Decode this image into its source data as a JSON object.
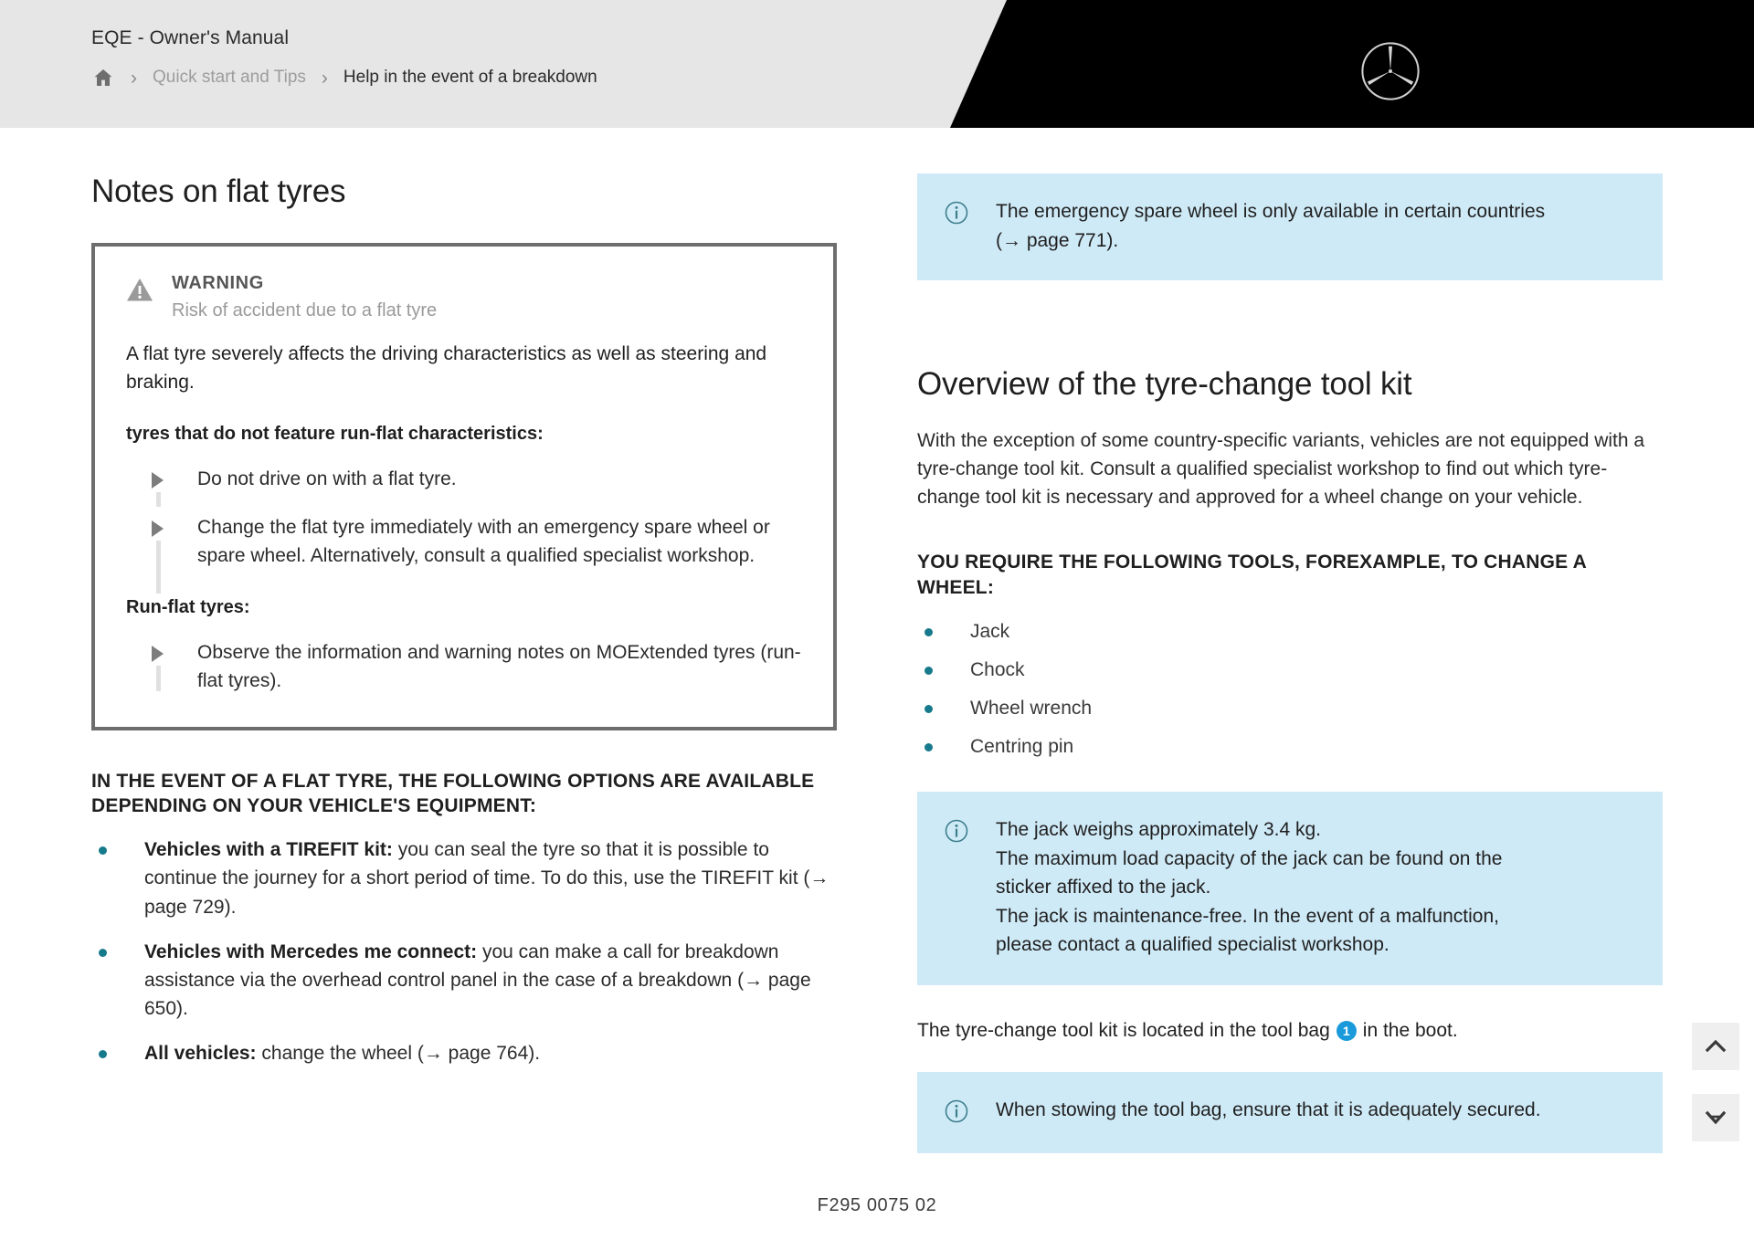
{
  "header": {
    "manual_title": "EQE - Owner's Manual",
    "breadcrumb": {
      "home_icon": "home-icon",
      "separator": "›",
      "parent": "Quick start and Tips",
      "current": "Help in the event of a breakdown"
    },
    "brand_logo": "mercedes-benz-star-icon",
    "colors": {
      "header_bg": "#e6e6e6",
      "banner_black": "#000000"
    }
  },
  "left_column": {
    "section_title": "Notes on flat tyres",
    "warning_box": {
      "icon": "warning-triangle-icon",
      "label": "WARNING",
      "subtitle": "Risk of accident due to a flat tyre",
      "body": "A flat tyre severely affects the driving characteristics as well as steering and braking.",
      "groups": [
        {
          "heading": "tyres that do not feature run-flat characteristics:",
          "items": [
            "Do not drive on with a flat tyre.",
            "Change the flat tyre immediately with an emergency spare wheel or spare wheel. Alternatively, consult a qualified specialist workshop."
          ]
        },
        {
          "heading": "Run-flat tyres:",
          "items": [
            "Observe the information and warning notes on MOExtended tyres (run-flat tyres)."
          ]
        }
      ]
    },
    "options_heading": "IN THE EVENT OF A FLAT TYRE, THE FOLLOWING OPTIONS ARE AVAILABLE DEPENDING ON YOUR VEHICLE'S EQUIPMENT:",
    "options": [
      {
        "bold": "Vehicles with a TIREFIT kit:",
        "rest": " you can seal the tyre so that it is possible to continue the journey for a short period of time. To do this, use the TIREFIT kit (→ page 729)."
      },
      {
        "bold": "Vehicles with Mercedes me connect:",
        "rest": " you can make a call for breakdown assistance via the overhead control panel in the case of a breakdown (→ page 650)."
      },
      {
        "bold": "All vehicles:",
        "rest": " change the wheel (→ page 764)."
      }
    ]
  },
  "right_column": {
    "info_box_top": {
      "icon": "info-circle-icon",
      "lines": [
        "The emergency spare wheel is only available in certain countries",
        "(→ page 771)."
      ]
    },
    "section_title": "Overview of the tyre-change tool kit",
    "paragraph": "With the exception of some country-specific variants, vehicles are not equipped with a tyre-change tool kit. Consult a qualified specialist workshop to find out which tyre-change tool kit is necessary and approved for a wheel change on your vehicle.",
    "tools_heading": "YOU REQUIRE THE FOLLOWING TOOLS, FOREXAMPLE, TO CHANGE A WHEEL:",
    "tools": [
      "Jack",
      "Chock",
      "Wheel wrench",
      "Centring pin"
    ],
    "info_box_jack": {
      "icon": "info-circle-icon",
      "lines": [
        "The jack weighs approximately 3.4 kg.",
        "The maximum load capacity of the jack can be found on the",
        "sticker affixed to the jack.",
        "The jack is maintenance-free. In the event of a malfunction,",
        "please contact a qualified specialist workshop."
      ]
    },
    "tool_bag_line": {
      "before": "The tyre-change tool kit is located in the tool bag",
      "badge": "1",
      "after": "in the boot."
    },
    "info_box_stow": {
      "icon": "info-circle-icon",
      "lines": [
        "When stowing the tool bag, ensure that it is adequately secured."
      ]
    }
  },
  "side_buttons": [
    {
      "name": "scroll-to-top-button",
      "icon": "chevron-up-icon"
    },
    {
      "name": "next-page-button",
      "icon": "chevron-down-mark-icon"
    }
  ],
  "footer": {
    "document_code": "F295 0075 02"
  },
  "colors": {
    "info_box_bg": "#cfeaf7",
    "bullet_teal": "#177a8c",
    "badge_blue": "#1a9ada",
    "warning_border": "#6e6e6e"
  }
}
